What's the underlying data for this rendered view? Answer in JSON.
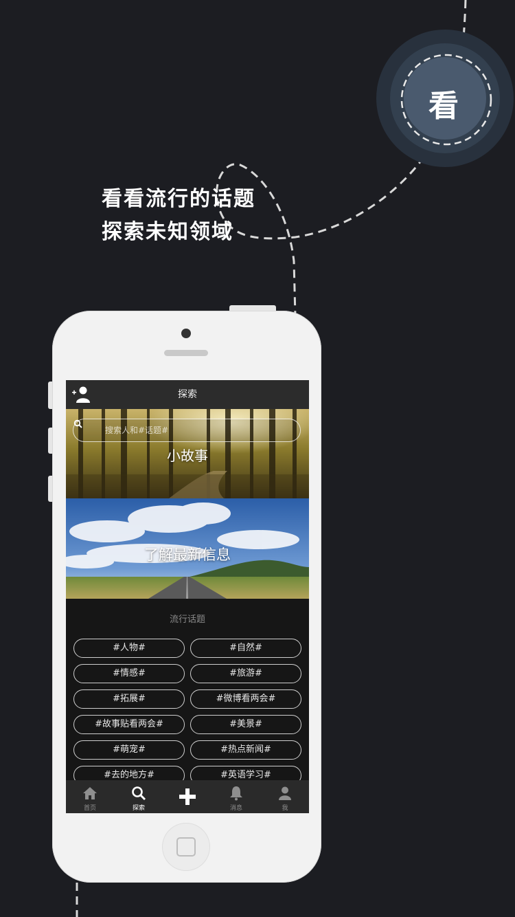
{
  "promo": {
    "badge_char": "看",
    "slogan_line1": "看看流行的话题",
    "slogan_line2": "探索未知领域"
  },
  "app": {
    "nav_title": "探索",
    "search_placeholder": "搜索人和#话题#",
    "banners": [
      {
        "label": "小故事"
      },
      {
        "label": "了解最新信息"
      }
    ],
    "section_title": "流行话题",
    "topics": [
      "#人物#",
      "#自然#",
      "#情感#",
      "#旅游#",
      "#拓展#",
      "#微博看两会#",
      "#故事贴看两会#",
      "#美景#",
      "#萌宠#",
      "#热点新闻#",
      "#去的地方#",
      "#英语学习#"
    ],
    "tabbar": {
      "items": [
        {
          "label": "首页",
          "icon": "home-icon"
        },
        {
          "label": "探索",
          "icon": "search-icon",
          "active": true
        },
        {
          "label": "",
          "icon": "plus-icon"
        },
        {
          "label": "消息",
          "icon": "bell-icon"
        },
        {
          "label": "我",
          "icon": "user-icon"
        }
      ]
    }
  },
  "colors": {
    "background": "#1c1d22",
    "badge_outer": "#33404f",
    "badge_inner": "#4a5a6e",
    "phone_body": "#f2f2f2"
  }
}
